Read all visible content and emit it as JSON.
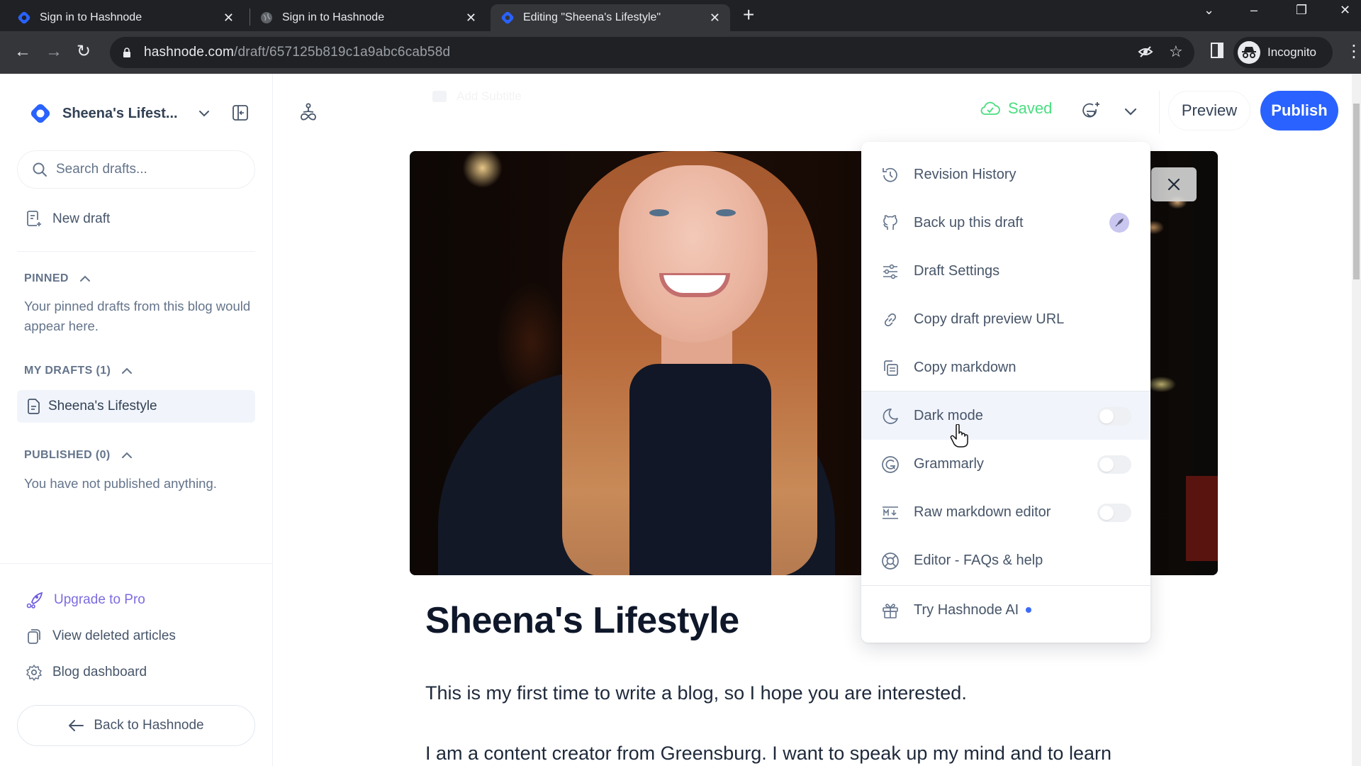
{
  "browser": {
    "tabs": [
      {
        "title": "Sign in to Hashnode",
        "favicon": "hashnode-logo-icon",
        "active": false
      },
      {
        "title": "Sign in to Hashnode",
        "favicon": "globe-icon",
        "active": false
      },
      {
        "title": "Editing \"Sheena's Lifestyle\"",
        "favicon": "hashnode-logo-icon",
        "active": true
      }
    ],
    "url_domain": "hashnode.com",
    "url_path": "/draft/657125b819c1a9abc6cab58d",
    "profile_label": "Incognito"
  },
  "sidebar": {
    "blog_name": "Sheena's Lifest...",
    "search_placeholder": "Search drafts...",
    "new_draft_label": "New draft",
    "sections": {
      "pinned": {
        "heading": "PINNED",
        "empty_text": "Your pinned drafts from this blog would appear here."
      },
      "my_drafts": {
        "heading": "MY DRAFTS (1)",
        "items": [
          {
            "title": "Sheena's Lifestyle"
          }
        ]
      },
      "published": {
        "heading": "PUBLISHED (0)",
        "empty_text": "You have not published anything."
      }
    },
    "footer_links": [
      {
        "label": "Upgrade to Pro",
        "icon": "rocket-icon"
      },
      {
        "label": "View deleted articles",
        "icon": "copy-pages-icon"
      },
      {
        "label": "Blog dashboard",
        "icon": "gear-icon"
      }
    ],
    "back_button_label": "Back to Hashnode"
  },
  "toolbar": {
    "subtitle_label": "Add Subtitle",
    "status_label": "Saved",
    "preview_label": "Preview",
    "publish_label": "Publish"
  },
  "colors": {
    "brand_blue": "#2962ff",
    "saved_green": "#4ade80",
    "upgrade_purple": "#7c6ce0"
  },
  "article": {
    "title": "Sheena's Lifestyle",
    "paragraphs": [
      "This is my first time to write a blog, so I hope you are interested.",
      "I am a content creator from Greensburg. I want to speak up my mind and to learn"
    ]
  },
  "menu": {
    "items": [
      {
        "label": "Revision History",
        "icon": "history-icon"
      },
      {
        "label": "Back up this draft",
        "icon": "github-icon",
        "badge": "pro-rocket-badge"
      },
      {
        "label": "Draft Settings",
        "icon": "sliders-icon"
      },
      {
        "label": "Copy draft preview URL",
        "icon": "link-icon"
      },
      {
        "label": "Copy markdown",
        "icon": "copy-markdown-icon"
      },
      {
        "label": "Dark mode",
        "icon": "moon-icon",
        "toggle": false
      },
      {
        "label": "Grammarly",
        "icon": "grammarly-icon",
        "toggle": false
      },
      {
        "label": "Raw markdown editor",
        "icon": "markdown-icon",
        "toggle": false
      },
      {
        "label": "Editor - FAQs & help",
        "icon": "lifebuoy-icon"
      },
      {
        "label": "Try Hashnode AI",
        "icon": "gift-icon",
        "new_indicator": true
      }
    ]
  }
}
